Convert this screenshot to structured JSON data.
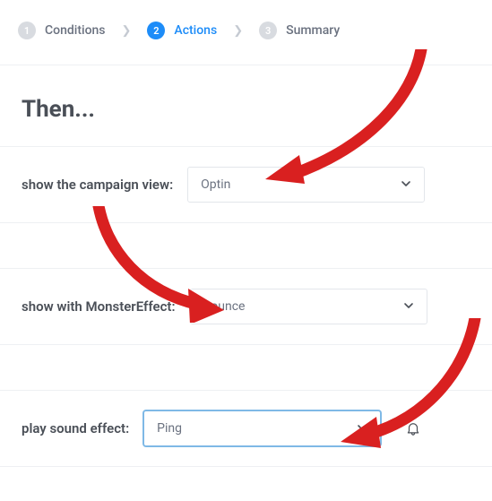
{
  "steps": [
    {
      "num": "1",
      "label": "Conditions",
      "active": false
    },
    {
      "num": "2",
      "label": "Actions",
      "active": true
    },
    {
      "num": "3",
      "label": "Summary",
      "active": false
    }
  ],
  "heading": "Then...",
  "fields": {
    "campaignView": {
      "label": "show the campaign view:",
      "value": "Optin"
    },
    "monsterEffect": {
      "label": "show with MonsterEffect:",
      "value": "Bounce"
    },
    "soundEffect": {
      "label": "play sound effect:",
      "value": "Ping"
    }
  }
}
